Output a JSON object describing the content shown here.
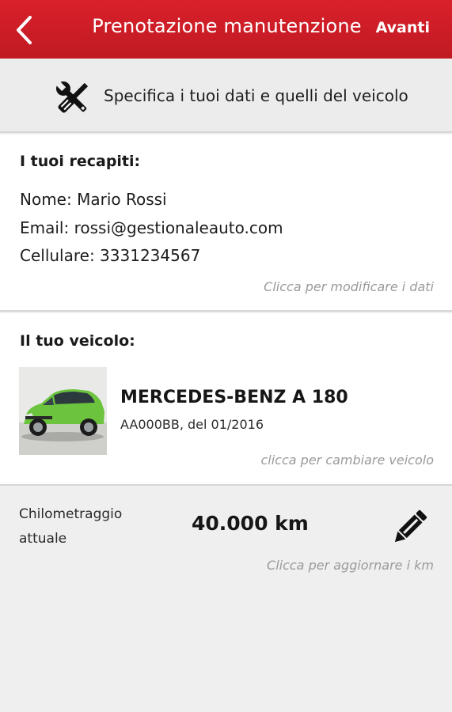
{
  "header": {
    "title": "Prenotazione manutenzione",
    "next_label": "Avanti",
    "back_icon": "chevron-left-icon"
  },
  "intro": {
    "icon": "tools-icon",
    "text": "Specifica i tuoi dati e quelli del veicolo"
  },
  "contacts": {
    "heading": "I tuoi recapiti:",
    "name_line": "Nome: Mario Rossi",
    "email_line": "Email: rossi@gestionaleauto.com",
    "phone_line": "Cellulare: 3331234567",
    "edit_hint": "Clicca per modificare i dati"
  },
  "vehicle": {
    "heading": "Il tuo veicolo:",
    "name": "MERCEDES-BENZ A 180",
    "details": "AA000BB, del 01/2016",
    "change_hint": "clicca per cambiare veicolo",
    "car_color": "#6cc43e"
  },
  "mileage": {
    "label": "Chilometraggio attuale",
    "value": "40.000 km",
    "update_hint": "Clicca per aggiornare i km",
    "edit_icon": "pencil-icon"
  },
  "colors": {
    "brand_red": "#c81d26",
    "hint_gray": "#9a9a9a"
  }
}
